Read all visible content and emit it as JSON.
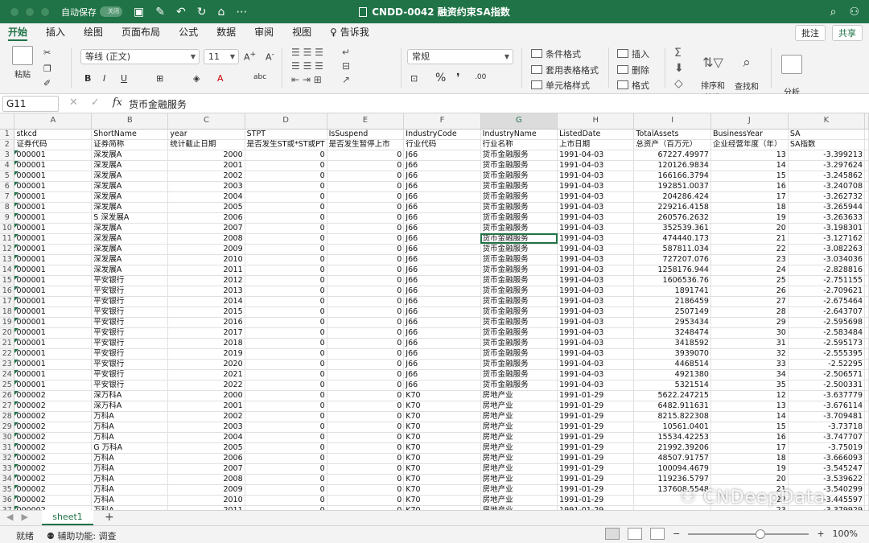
{
  "window": {
    "autosave_label": "自动保存",
    "autosave_state": "关闭",
    "title": "CNDD-0042 融资约束SA指数"
  },
  "tabs": [
    "开始",
    "插入",
    "绘图",
    "页面布局",
    "公式",
    "数据",
    "审阅",
    "视图",
    "告诉我"
  ],
  "tab_actions": {
    "comment": "批注",
    "share": "共享"
  },
  "ribbon": {
    "paste": "粘贴",
    "font_name": "等线 (正文)",
    "font_size": "11",
    "number_format": "常规",
    "conditional_format": "条件格式",
    "table_format": "套用表格格式",
    "cell_style": "单元格样式",
    "insert": "插入",
    "delete": "删除",
    "format": "格式",
    "sort_filter": "排序和\n筛选",
    "find_select": "查找和\n选择",
    "analyze": "分析\n数据"
  },
  "formula_bar": {
    "name_box": "G11",
    "value": "货币金融服务"
  },
  "columns": [
    "A",
    "B",
    "C",
    "D",
    "E",
    "F",
    "G",
    "H",
    "I",
    "J",
    "K"
  ],
  "header_rows": [
    [
      "stkcd",
      "ShortName",
      "year",
      "STPT",
      "IsSuspend",
      "IndustryCode",
      "IndustryName",
      "ListedDate",
      "TotalAssets",
      "BusinessYear",
      "SA"
    ],
    [
      "证券代码",
      "证券简称",
      "统计截止日期",
      "是否发生ST或*ST或PT",
      "是否发生暂停上市",
      "行业代码",
      "行业名称",
      "上市日期",
      "总资产（百万元）",
      "企业经营年度（年）",
      "SA指数"
    ]
  ],
  "rows": [
    [
      "000001",
      "深发展A",
      "2000",
      "0",
      "0",
      "J66",
      "货币金融服务",
      "1991-04-03",
      "67227.49977",
      "13",
      "-3.399213"
    ],
    [
      "000001",
      "深发展A",
      "2001",
      "0",
      "0",
      "J66",
      "货币金融服务",
      "1991-04-03",
      "120126.9834",
      "14",
      "-3.297624"
    ],
    [
      "000001",
      "深发展A",
      "2002",
      "0",
      "0",
      "J66",
      "货币金融服务",
      "1991-04-03",
      "166166.3794",
      "15",
      "-3.245862"
    ],
    [
      "000001",
      "深发展A",
      "2003",
      "0",
      "0",
      "J66",
      "货币金融服务",
      "1991-04-03",
      "192851.0037",
      "16",
      "-3.240708"
    ],
    [
      "000001",
      "深发展A",
      "2004",
      "0",
      "0",
      "J66",
      "货币金融服务",
      "1991-04-03",
      "204286.424",
      "17",
      "-3.262732"
    ],
    [
      "000001",
      "深发展A",
      "2005",
      "0",
      "0",
      "J66",
      "货币金融服务",
      "1991-04-03",
      "229216.4158",
      "18",
      "-3.265944"
    ],
    [
      "000001",
      "S 深发展A",
      "2006",
      "0",
      "0",
      "J66",
      "货币金融服务",
      "1991-04-03",
      "260576.2632",
      "19",
      "-3.263633"
    ],
    [
      "000001",
      "深发展A",
      "2007",
      "0",
      "0",
      "J66",
      "货币金融服务",
      "1991-04-03",
      "352539.361",
      "20",
      "-3.198301"
    ],
    [
      "000001",
      "深发展A",
      "2008",
      "0",
      "0",
      "J66",
      "货币金融服务",
      "1991-04-03",
      "474440.173",
      "21",
      "-3.127162"
    ],
    [
      "000001",
      "深发展A",
      "2009",
      "0",
      "0",
      "J66",
      "货币金融服务",
      "1991-04-03",
      "587811.034",
      "22",
      "-3.082263"
    ],
    [
      "000001",
      "深发展A",
      "2010",
      "0",
      "0",
      "J66",
      "货币金融服务",
      "1991-04-03",
      "727207.076",
      "23",
      "-3.034036"
    ],
    [
      "000001",
      "深发展A",
      "2011",
      "0",
      "0",
      "J66",
      "货币金融服务",
      "1991-04-03",
      "1258176.944",
      "24",
      "-2.828816"
    ],
    [
      "000001",
      "平安银行",
      "2012",
      "0",
      "0",
      "J66",
      "货币金融服务",
      "1991-04-03",
      "1606536.76",
      "25",
      "-2.751155"
    ],
    [
      "000001",
      "平安银行",
      "2013",
      "0",
      "0",
      "J66",
      "货币金融服务",
      "1991-04-03",
      "1891741",
      "26",
      "-2.709621"
    ],
    [
      "000001",
      "平安银行",
      "2014",
      "0",
      "0",
      "J66",
      "货币金融服务",
      "1991-04-03",
      "2186459",
      "27",
      "-2.675464"
    ],
    [
      "000001",
      "平安银行",
      "2015",
      "0",
      "0",
      "J66",
      "货币金融服务",
      "1991-04-03",
      "2507149",
      "28",
      "-2.643707"
    ],
    [
      "000001",
      "平安银行",
      "2016",
      "0",
      "0",
      "J66",
      "货币金融服务",
      "1991-04-03",
      "2953434",
      "29",
      "-2.595698"
    ],
    [
      "000001",
      "平安银行",
      "2017",
      "0",
      "0",
      "J66",
      "货币金融服务",
      "1991-04-03",
      "3248474",
      "30",
      "-2.583484"
    ],
    [
      "000001",
      "平安银行",
      "2018",
      "0",
      "0",
      "J66",
      "货币金融服务",
      "1991-04-03",
      "3418592",
      "31",
      "-2.595173"
    ],
    [
      "000001",
      "平安银行",
      "2019",
      "0",
      "0",
      "J66",
      "货币金融服务",
      "1991-04-03",
      "3939070",
      "32",
      "-2.555395"
    ],
    [
      "000001",
      "平安银行",
      "2020",
      "0",
      "0",
      "J66",
      "货币金融服务",
      "1991-04-03",
      "4468514",
      "33",
      "-2.52295"
    ],
    [
      "000001",
      "平安银行",
      "2021",
      "0",
      "0",
      "J66",
      "货币金融服务",
      "1991-04-03",
      "4921380",
      "34",
      "-2.506571"
    ],
    [
      "000001",
      "平安银行",
      "2022",
      "0",
      "0",
      "J66",
      "货币金融服务",
      "1991-04-03",
      "5321514",
      "35",
      "-2.500331"
    ],
    [
      "000002",
      "深万科A",
      "2000",
      "0",
      "0",
      "K70",
      "房地产业",
      "1991-01-29",
      "5622.247215",
      "12",
      "-3.637779"
    ],
    [
      "000002",
      "深万科A",
      "2001",
      "0",
      "0",
      "K70",
      "房地产业",
      "1991-01-29",
      "6482.911631",
      "13",
      "-3.676114"
    ],
    [
      "000002",
      "万科A",
      "2002",
      "0",
      "0",
      "K70",
      "房地产业",
      "1991-01-29",
      "8215.822308",
      "14",
      "-3.709481"
    ],
    [
      "000002",
      "万科A",
      "2003",
      "0",
      "0",
      "K70",
      "房地产业",
      "1991-01-29",
      "10561.0401",
      "15",
      "-3.73718"
    ],
    [
      "000002",
      "万科A",
      "2004",
      "0",
      "0",
      "K70",
      "房地产业",
      "1991-01-29",
      "15534.42253",
      "16",
      "-3.747707"
    ],
    [
      "000002",
      "G 万科A",
      "2005",
      "0",
      "0",
      "K70",
      "房地产业",
      "1991-01-29",
      "21992.39206",
      "17",
      "-3.75019"
    ],
    [
      "000002",
      "万科A",
      "2006",
      "0",
      "0",
      "K70",
      "房地产业",
      "1991-01-29",
      "48507.91757",
      "18",
      "-3.666093"
    ],
    [
      "000002",
      "万科A",
      "2007",
      "0",
      "0",
      "K70",
      "房地产业",
      "1991-01-29",
      "100094.4679",
      "19",
      "-3.545247"
    ],
    [
      "000002",
      "万科A",
      "2008",
      "0",
      "0",
      "K70",
      "房地产业",
      "1991-01-29",
      "119236.5797",
      "20",
      "-3.539622"
    ],
    [
      "000002",
      "万科A",
      "2009",
      "0",
      "0",
      "K70",
      "房地产业",
      "1991-01-29",
      "137608.5548",
      "21",
      "-3.540299"
    ],
    [
      "000002",
      "万科A",
      "2010",
      "0",
      "0",
      "K70",
      "房地产业",
      "1991-01-29",
      "",
      "22",
      "-3.445597"
    ],
    [
      "000002",
      "万科A",
      "2011",
      "0",
      "0",
      "K70",
      "房地产业",
      "1991-01-29",
      "",
      "23",
      "-3.379929"
    ]
  ],
  "sheet_tab": "sheet1",
  "status": {
    "ready": "就绪",
    "accessibility": "辅助功能: 调查",
    "zoom": "100%"
  },
  "watermark": "CNDeepData",
  "colors": {
    "accent": "#1f7346"
  }
}
